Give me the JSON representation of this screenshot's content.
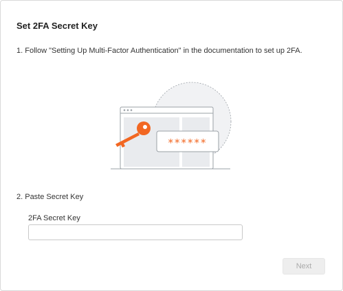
{
  "dialog": {
    "title": "Set 2FA Secret Key",
    "step1_text": "1. Follow \"Setting Up Multi-Factor Authentication\" in the documentation to set up 2FA.",
    "illustration": {
      "icon": "key-password-illustration",
      "masked_password": "******"
    },
    "step2_text": "2. Paste Secret Key",
    "secret_key_field": {
      "label": "2FA Secret Key",
      "value": "",
      "placeholder": ""
    },
    "next_button": {
      "label": "Next",
      "disabled": true
    }
  },
  "colors": {
    "accent": "#f26722",
    "disabled_button_bg": "#eeeeee",
    "disabled_button_text": "#aaaaaa",
    "border": "#d9d9d9"
  }
}
